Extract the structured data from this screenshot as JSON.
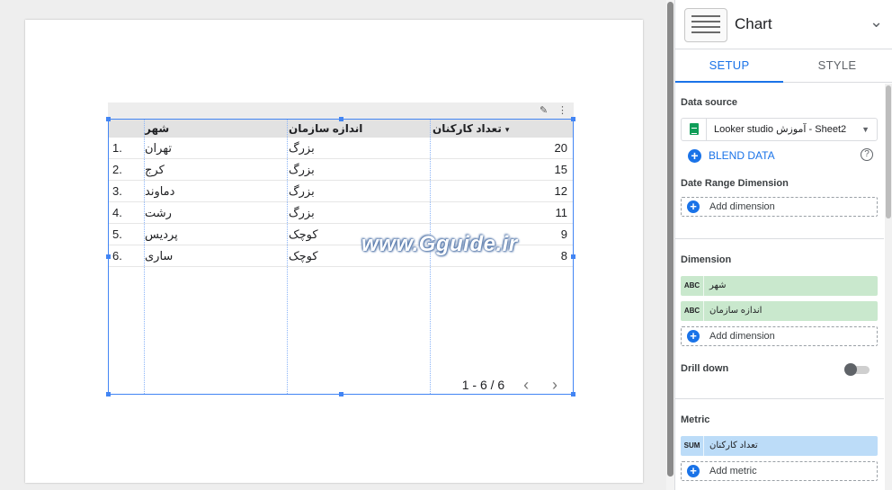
{
  "table": {
    "headers": {
      "city": "شهر",
      "org_size": "اندازه سازمان",
      "employees": "تعداد کارکنان"
    },
    "rows": [
      {
        "idx": "1.",
        "city": "تهران",
        "size": "بزرگ",
        "count": "20"
      },
      {
        "idx": "2.",
        "city": "کرج",
        "size": "بزرگ",
        "count": "15"
      },
      {
        "idx": "3.",
        "city": "دماوند",
        "size": "بزرگ",
        "count": "12"
      },
      {
        "idx": "4.",
        "city": "رشت",
        "size": "بزرگ",
        "count": "11"
      },
      {
        "idx": "5.",
        "city": "پردیس",
        "size": "کوچک",
        "count": "9"
      },
      {
        "idx": "6.",
        "city": "ساری",
        "size": "کوچک",
        "count": "8"
      }
    ],
    "pagination": "1 - 6 / 6",
    "sort_indicator": "▾"
  },
  "watermark": "www.Gguide.ir",
  "panel": {
    "title": "Chart",
    "tabs": [
      {
        "label": "SETUP",
        "active": true
      },
      {
        "label": "STYLE",
        "active": false
      }
    ],
    "data_source": {
      "label": "Data source",
      "value": "Looker studio آموزش - Sheet2",
      "blend_label": "BLEND DATA"
    },
    "date_range": {
      "label": "Date Range Dimension",
      "add_label": "Add dimension"
    },
    "dimension": {
      "label": "Dimension",
      "fields": [
        {
          "type": "ABC",
          "name": "شهر"
        },
        {
          "type": "ABC",
          "name": "اندازه سازمان"
        }
      ],
      "add_label": "Add dimension"
    },
    "drill_down": {
      "label": "Drill down",
      "enabled": false
    },
    "metric": {
      "label": "Metric",
      "fields": [
        {
          "type": "SUM",
          "name": "تعداد کارکنان"
        }
      ],
      "add_label": "Add metric"
    }
  },
  "colors": {
    "accent": "#1a73e8",
    "selection_border": "#4285f4",
    "dimension_chip": "#c9e8cd",
    "metric_chip": "#bcdcf8"
  },
  "icons": {
    "edit": "pencil-icon",
    "more": "more-vert-icon",
    "chart_type": "table-chart-icon",
    "collapse": "chevron-down-icon",
    "sheets": "google-sheets-icon",
    "help": "help-icon",
    "prev": "chevron-left-icon",
    "next": "chevron-right-icon"
  }
}
